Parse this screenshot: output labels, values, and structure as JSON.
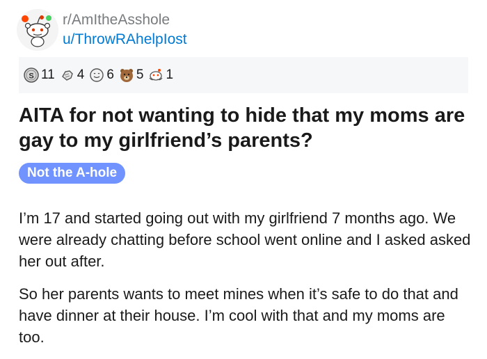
{
  "header": {
    "subreddit": "r/AmItheAsshole",
    "username": "u/ThrowRAhelpIost",
    "avatar_icon": "reddit-snoo-icon"
  },
  "awards": [
    {
      "icon": "silver-award-icon",
      "count": "11"
    },
    {
      "icon": "helpful-award-icon",
      "count": "4"
    },
    {
      "icon": "wholesome-award-icon",
      "count": "6"
    },
    {
      "icon": "bear-award-icon",
      "count": "5"
    },
    {
      "icon": "snoo-hug-award-icon",
      "count": "1"
    }
  ],
  "post": {
    "title": "AITA for not wanting to hide that my moms are gay to my girlfriend’s parents?",
    "flair": "Not the A-hole",
    "flair_color": "#7193ff",
    "body": [
      "I’m 17 and started going out with my girlfriend 7 months ago. We were already chatting before school went online and I asked asked her out after.",
      "So her parents wants to meet mines when it’s safe to do that and have dinner at their house. I’m cool with that and my moms are too."
    ]
  },
  "colors": {
    "username": "#0079d3",
    "subreddit": "#787c7e",
    "awards_bg": "#f6f7f8"
  }
}
